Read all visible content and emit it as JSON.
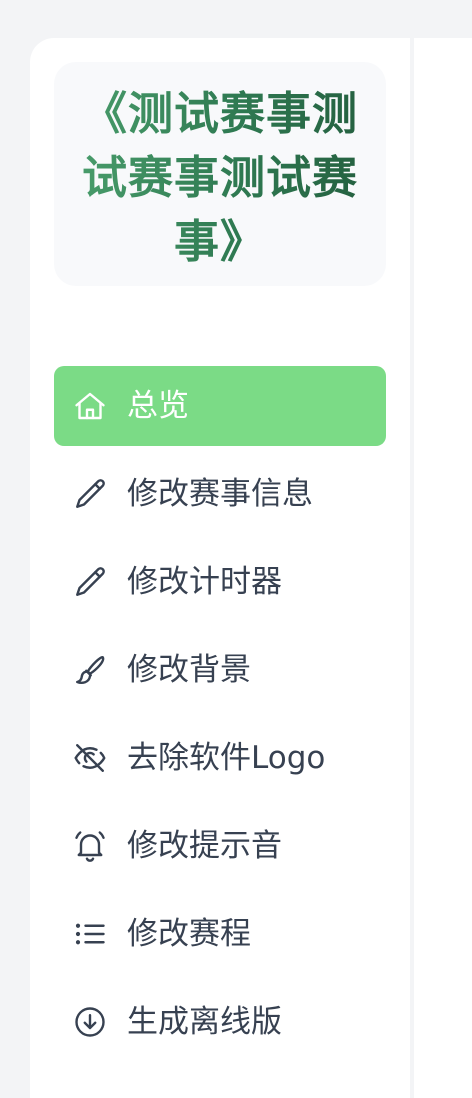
{
  "app": {
    "title": "《测试赛事测试赛事测试赛事》"
  },
  "colors": {
    "accent": "#7bdb86",
    "title_green": "#3a8a5e",
    "text": "#374151"
  },
  "menu": {
    "items": [
      {
        "label": "总览",
        "icon": "home-icon",
        "active": true
      },
      {
        "label": "修改赛事信息",
        "icon": "pencil-icon",
        "active": false
      },
      {
        "label": "修改计时器",
        "icon": "pencil-icon",
        "active": false
      },
      {
        "label": "修改背景",
        "icon": "paintbrush-icon",
        "active": false
      },
      {
        "label": "去除软件Logo",
        "icon": "eye-off-icon",
        "active": false
      },
      {
        "label": "修改提示音",
        "icon": "bell-icon",
        "active": false
      },
      {
        "label": "修改赛程",
        "icon": "list-icon",
        "active": false
      },
      {
        "label": "生成离线版",
        "icon": "download-circle-icon",
        "active": false
      }
    ]
  }
}
